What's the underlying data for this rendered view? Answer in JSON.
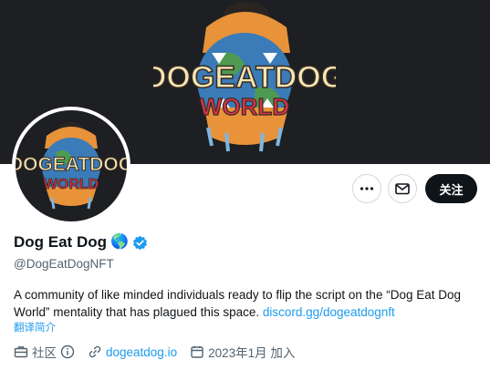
{
  "profile": {
    "display_name": "Dog Eat Dog",
    "name_emoji": "🌎",
    "handle": "@DogEatDogNFT",
    "bio_text": "A community of like minded individuals ready to flip the script on the “Dog Eat Dog World” mentality that has plagued this space. ",
    "bio_link": "discord.gg/dogeatdognft",
    "translate_label": "翻译简介",
    "verified_color": "#1d9bf0"
  },
  "logo": {
    "line1": "DOGEATDOG",
    "line2": "WORLD"
  },
  "actions": {
    "more_icon": "more-dots-icon",
    "message_icon": "envelope-icon",
    "follow_label": "关注"
  },
  "meta": {
    "category": "社区",
    "website": "dogeatdog.io",
    "joined": "2023年1月 加入"
  }
}
